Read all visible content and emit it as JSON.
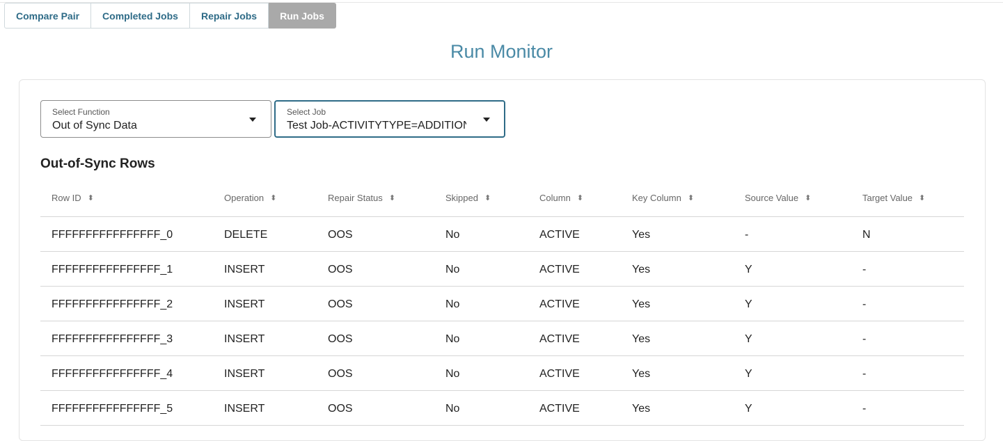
{
  "tabs": [
    {
      "label": "Compare Pair"
    },
    {
      "label": "Completed Jobs"
    },
    {
      "label": "Repair Jobs"
    },
    {
      "label": "Run Jobs",
      "active": true
    }
  ],
  "page_title": "Run Monitor",
  "select_function": {
    "label": "Select Function",
    "value": "Out of Sync Data"
  },
  "select_job": {
    "label": "Select Job",
    "value": "Test Job-ACTIVITYTYPE=ADDITION."
  },
  "section_title": "Out-of-Sync Rows",
  "table": {
    "columns": [
      "Row ID",
      "Operation",
      "Repair Status",
      "Skipped",
      "Column",
      "Key Column",
      "Source Value",
      "Target Value"
    ],
    "rows": [
      [
        "FFFFFFFFFFFFFFFF_0",
        "DELETE",
        "OOS",
        "No",
        "ACTIVE",
        "Yes",
        "-",
        "N"
      ],
      [
        "FFFFFFFFFFFFFFFF_1",
        "INSERT",
        "OOS",
        "No",
        "ACTIVE",
        "Yes",
        "Y",
        "-"
      ],
      [
        "FFFFFFFFFFFFFFFF_2",
        "INSERT",
        "OOS",
        "No",
        "ACTIVE",
        "Yes",
        "Y",
        "-"
      ],
      [
        "FFFFFFFFFFFFFFFF_3",
        "INSERT",
        "OOS",
        "No",
        "ACTIVE",
        "Yes",
        "Y",
        "-"
      ],
      [
        "FFFFFFFFFFFFFFFF_4",
        "INSERT",
        "OOS",
        "No",
        "ACTIVE",
        "Yes",
        "Y",
        "-"
      ],
      [
        "FFFFFFFFFFFFFFFF_5",
        "INSERT",
        "OOS",
        "No",
        "ACTIVE",
        "Yes",
        "Y",
        "-"
      ]
    ]
  },
  "colors": {
    "accent": "#2e6b87",
    "title": "#4a8aa6",
    "active_tab": "#a9a9a9"
  },
  "icons": {
    "sort": "sort-icon",
    "dropdown": "caret-down-icon"
  }
}
